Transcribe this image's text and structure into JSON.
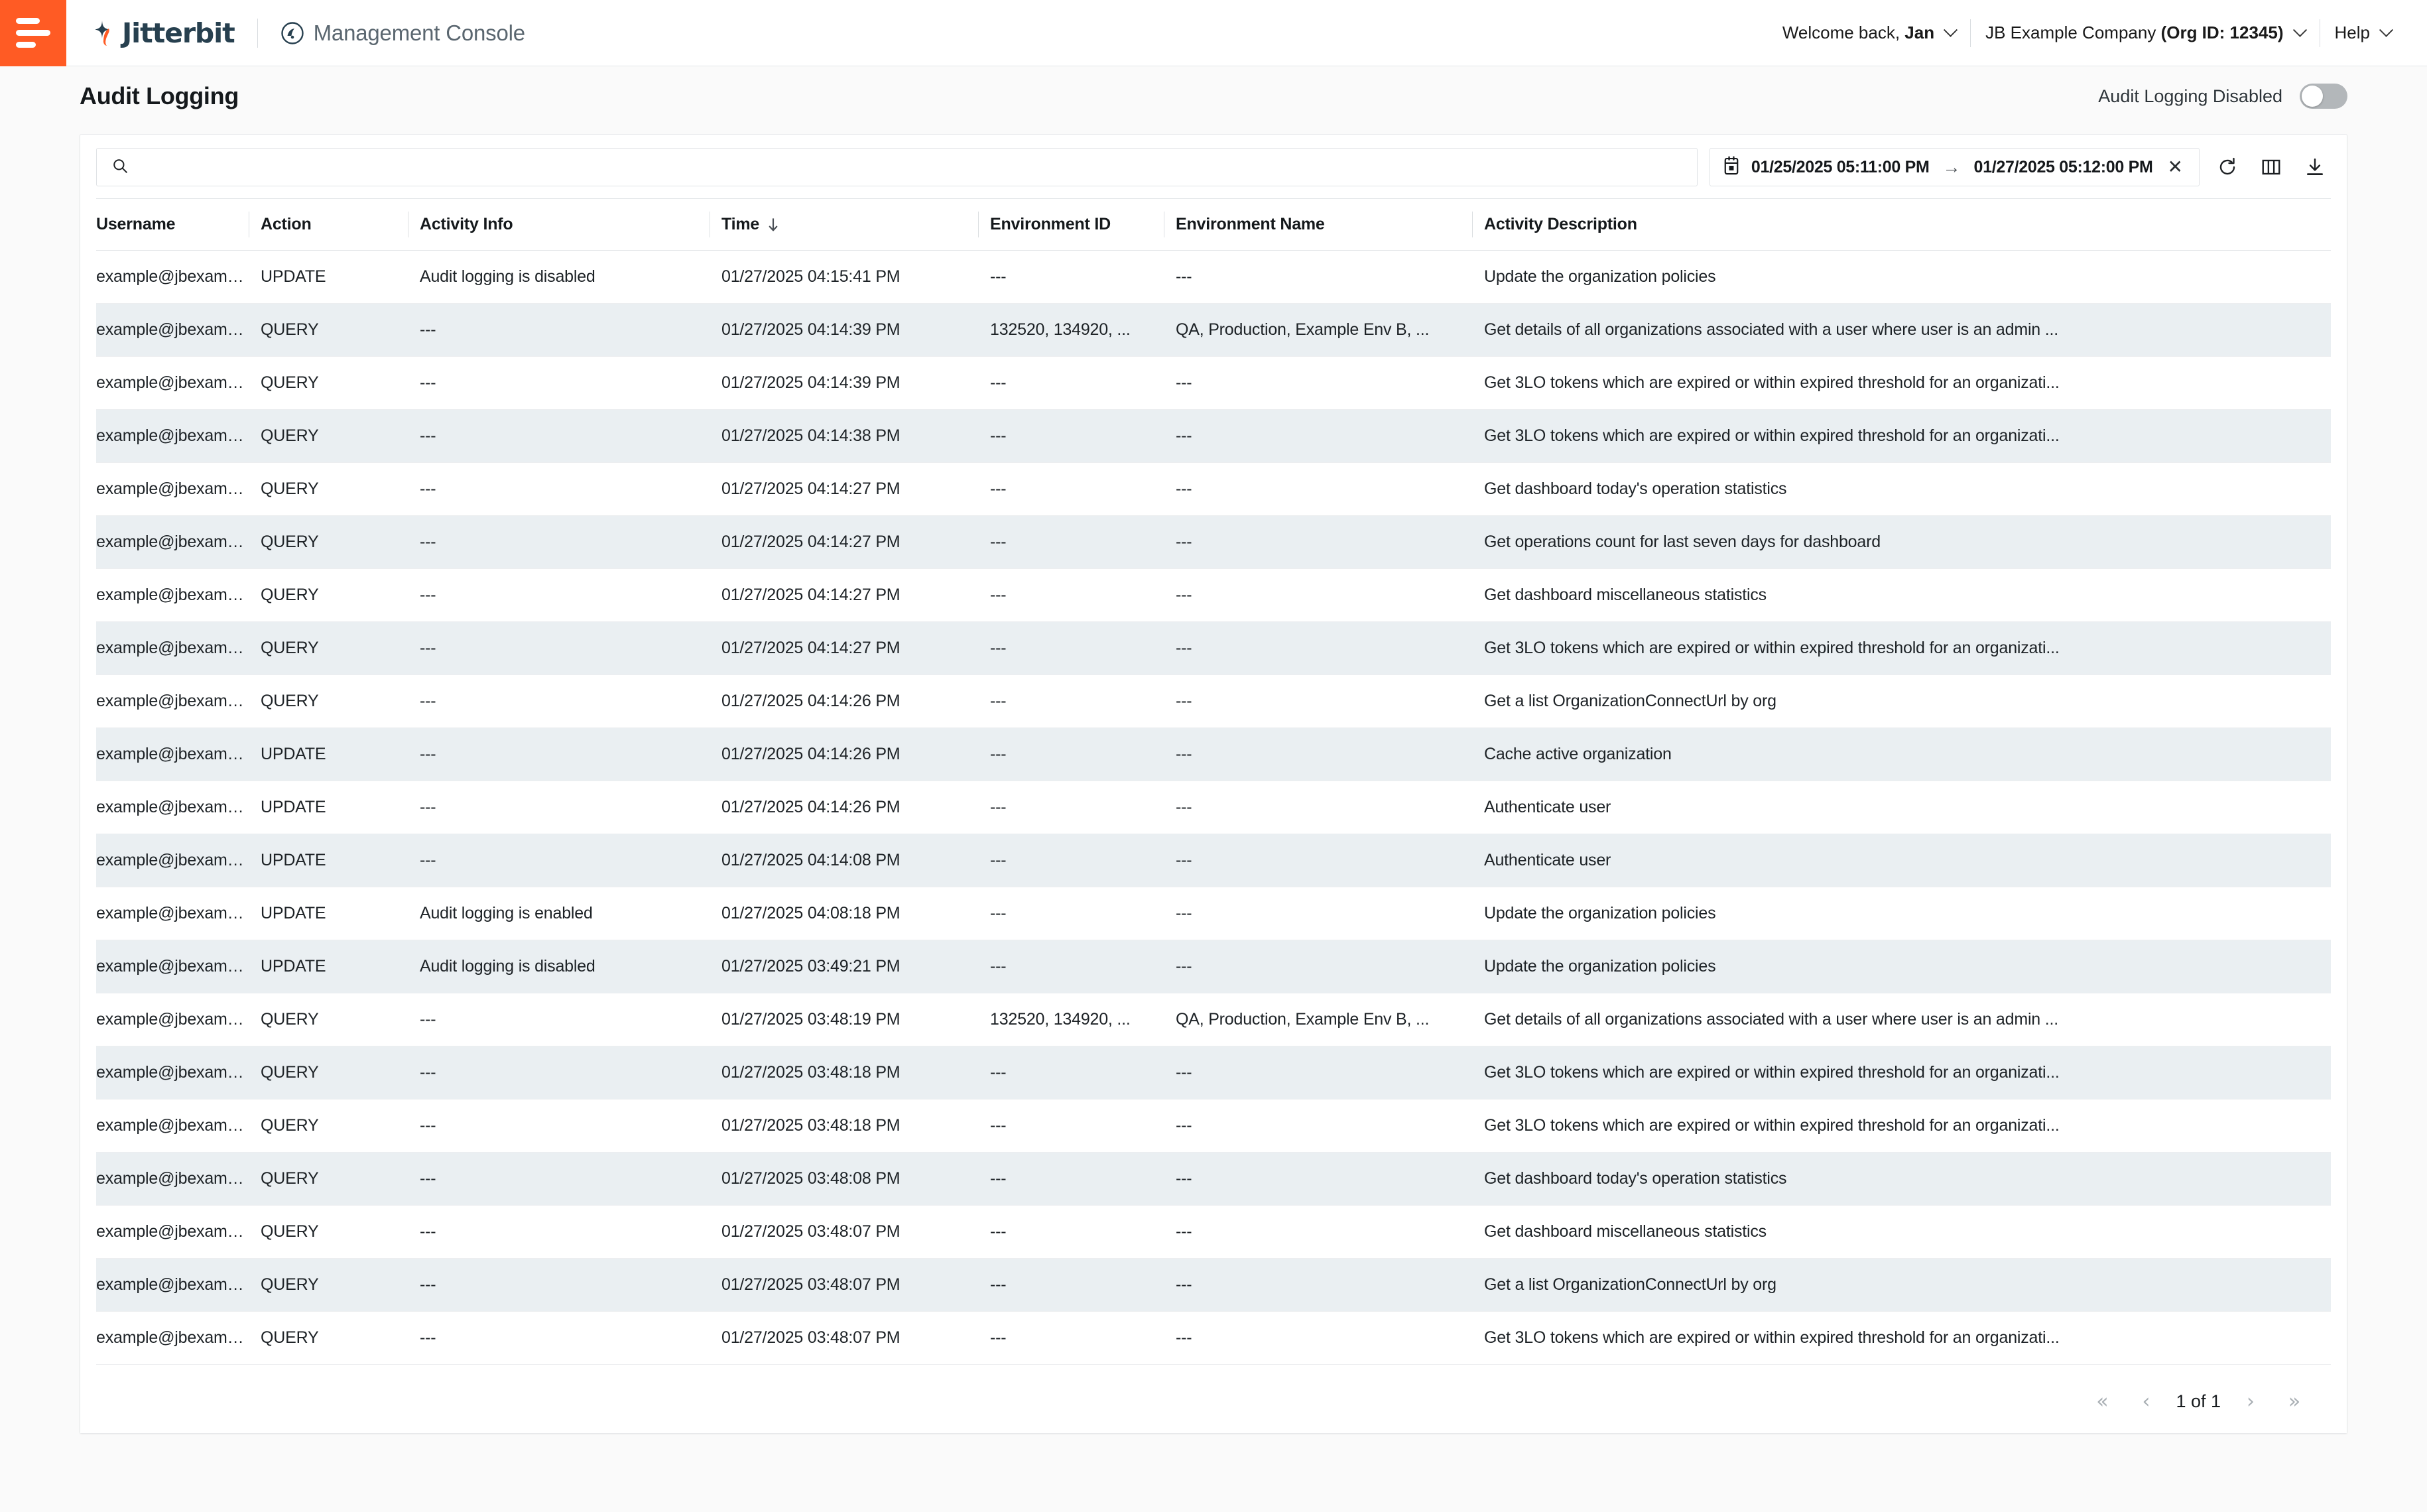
{
  "header": {
    "brand": "Jitterbit",
    "app_title": "Management Console",
    "welcome": "Welcome back, ",
    "user_name": "Jan",
    "org_prefix": "JB Example Company ",
    "org_id": "(Org ID: 12345)",
    "help": "Help"
  },
  "page": {
    "title": "Audit Logging",
    "toggle_label": "Audit Logging Disabled",
    "toggle_on": false
  },
  "toolbar": {
    "search_placeholder": "",
    "search_value": "",
    "date_start": "01/25/2025 05:11:00 PM",
    "date_end": "01/27/2025 05:12:00 PM",
    "range_arrow": "→",
    "clear_label": "✕"
  },
  "table": {
    "columns": [
      "Username",
      "Action",
      "Activity Info",
      "Time",
      "Environment ID",
      "Environment Name",
      "Activity Description"
    ],
    "sort_column": "Time",
    "sort_direction": "desc",
    "rows": [
      {
        "username": "example@jbexample.com",
        "action": "UPDATE",
        "activity_info": "Audit logging is disabled",
        "time": "01/27/2025 04:15:41 PM",
        "environment_id": "---",
        "environment_name": "---",
        "activity_description": "Update the organization policies"
      },
      {
        "username": "example@jbexample.com",
        "action": "QUERY",
        "activity_info": "---",
        "time": "01/27/2025 04:14:39 PM",
        "environment_id": "132520, 134920, ...",
        "environment_name": "QA, Production, Example Env B, ...",
        "activity_description": "Get details of all organizations associated with a user where user is an admin ..."
      },
      {
        "username": "example@jbexample.com",
        "action": "QUERY",
        "activity_info": "---",
        "time": "01/27/2025 04:14:39 PM",
        "environment_id": "---",
        "environment_name": "---",
        "activity_description": "Get 3LO tokens which are expired or within expired threshold for an organizati..."
      },
      {
        "username": "example@jbexample.com",
        "action": "QUERY",
        "activity_info": "---",
        "time": "01/27/2025 04:14:38 PM",
        "environment_id": "---",
        "environment_name": "---",
        "activity_description": "Get 3LO tokens which are expired or within expired threshold for an organizati..."
      },
      {
        "username": "example@jbexample.com",
        "action": "QUERY",
        "activity_info": "---",
        "time": "01/27/2025 04:14:27 PM",
        "environment_id": "---",
        "environment_name": "---",
        "activity_description": "Get dashboard today's operation statistics"
      },
      {
        "username": "example@jbexample.com",
        "action": "QUERY",
        "activity_info": "---",
        "time": "01/27/2025 04:14:27 PM",
        "environment_id": "---",
        "environment_name": "---",
        "activity_description": "Get operations count for last seven days for dashboard"
      },
      {
        "username": "example@jbexample.com",
        "action": "QUERY",
        "activity_info": "---",
        "time": "01/27/2025 04:14:27 PM",
        "environment_id": "---",
        "environment_name": "---",
        "activity_description": "Get dashboard miscellaneous statistics"
      },
      {
        "username": "example@jbexample.com",
        "action": "QUERY",
        "activity_info": "---",
        "time": "01/27/2025 04:14:27 PM",
        "environment_id": "---",
        "environment_name": "---",
        "activity_description": "Get 3LO tokens which are expired or within expired threshold for an organizati..."
      },
      {
        "username": "example@jbexample.com",
        "action": "QUERY",
        "activity_info": "---",
        "time": "01/27/2025 04:14:26 PM",
        "environment_id": "---",
        "environment_name": "---",
        "activity_description": "Get a list OrganizationConnectUrl by org"
      },
      {
        "username": "example@jbexample.com",
        "action": "UPDATE",
        "activity_info": "---",
        "time": "01/27/2025 04:14:26 PM",
        "environment_id": "---",
        "environment_name": "---",
        "activity_description": "Cache active organization"
      },
      {
        "username": "example@jbexample.com",
        "action": "UPDATE",
        "activity_info": "---",
        "time": "01/27/2025 04:14:26 PM",
        "environment_id": "---",
        "environment_name": "---",
        "activity_description": "Authenticate user"
      },
      {
        "username": "example@jbexample.com",
        "action": "UPDATE",
        "activity_info": "---",
        "time": "01/27/2025 04:14:08 PM",
        "environment_id": "---",
        "environment_name": "---",
        "activity_description": "Authenticate user"
      },
      {
        "username": "example@jbexample.com",
        "action": "UPDATE",
        "activity_info": "Audit logging is enabled",
        "time": "01/27/2025 04:08:18 PM",
        "environment_id": "---",
        "environment_name": "---",
        "activity_description": "Update the organization policies"
      },
      {
        "username": "example@jbexample.com",
        "action": "UPDATE",
        "activity_info": "Audit logging is disabled",
        "time": "01/27/2025 03:49:21 PM",
        "environment_id": "---",
        "environment_name": "---",
        "activity_description": "Update the organization policies"
      },
      {
        "username": "example@jbexample.com",
        "action": "QUERY",
        "activity_info": "---",
        "time": "01/27/2025 03:48:19 PM",
        "environment_id": "132520, 134920, ...",
        "environment_name": "QA, Production, Example Env B, ...",
        "activity_description": "Get details of all organizations associated with a user where user is an admin ..."
      },
      {
        "username": "example@jbexample.com",
        "action": "QUERY",
        "activity_info": "---",
        "time": "01/27/2025 03:48:18 PM",
        "environment_id": "---",
        "environment_name": "---",
        "activity_description": "Get 3LO tokens which are expired or within expired threshold for an organizati..."
      },
      {
        "username": "example@jbexample.com",
        "action": "QUERY",
        "activity_info": "---",
        "time": "01/27/2025 03:48:18 PM",
        "environment_id": "---",
        "environment_name": "---",
        "activity_description": "Get 3LO tokens which are expired or within expired threshold for an organizati..."
      },
      {
        "username": "example@jbexample.com",
        "action": "QUERY",
        "activity_info": "---",
        "time": "01/27/2025 03:48:08 PM",
        "environment_id": "---",
        "environment_name": "---",
        "activity_description": "Get dashboard today's operation statistics"
      },
      {
        "username": "example@jbexample.com",
        "action": "QUERY",
        "activity_info": "---",
        "time": "01/27/2025 03:48:07 PM",
        "environment_id": "---",
        "environment_name": "---",
        "activity_description": "Get dashboard miscellaneous statistics"
      },
      {
        "username": "example@jbexample.com",
        "action": "QUERY",
        "activity_info": "---",
        "time": "01/27/2025 03:48:07 PM",
        "environment_id": "---",
        "environment_name": "---",
        "activity_description": "Get a list OrganizationConnectUrl by org"
      },
      {
        "username": "example@jbexample.com",
        "action": "QUERY",
        "activity_info": "---",
        "time": "01/27/2025 03:48:07 PM",
        "environment_id": "---",
        "environment_name": "---",
        "activity_description": "Get 3LO tokens which are expired or within expired threshold for an organizati..."
      }
    ]
  },
  "pagination": {
    "first": "«",
    "prev": "‹",
    "label": "1 of 1",
    "next": "›",
    "last": "»"
  },
  "colors": {
    "brand_orange": "#ff5b24",
    "brand_navy": "#27404f",
    "row_stripe": "#eaeff2"
  }
}
